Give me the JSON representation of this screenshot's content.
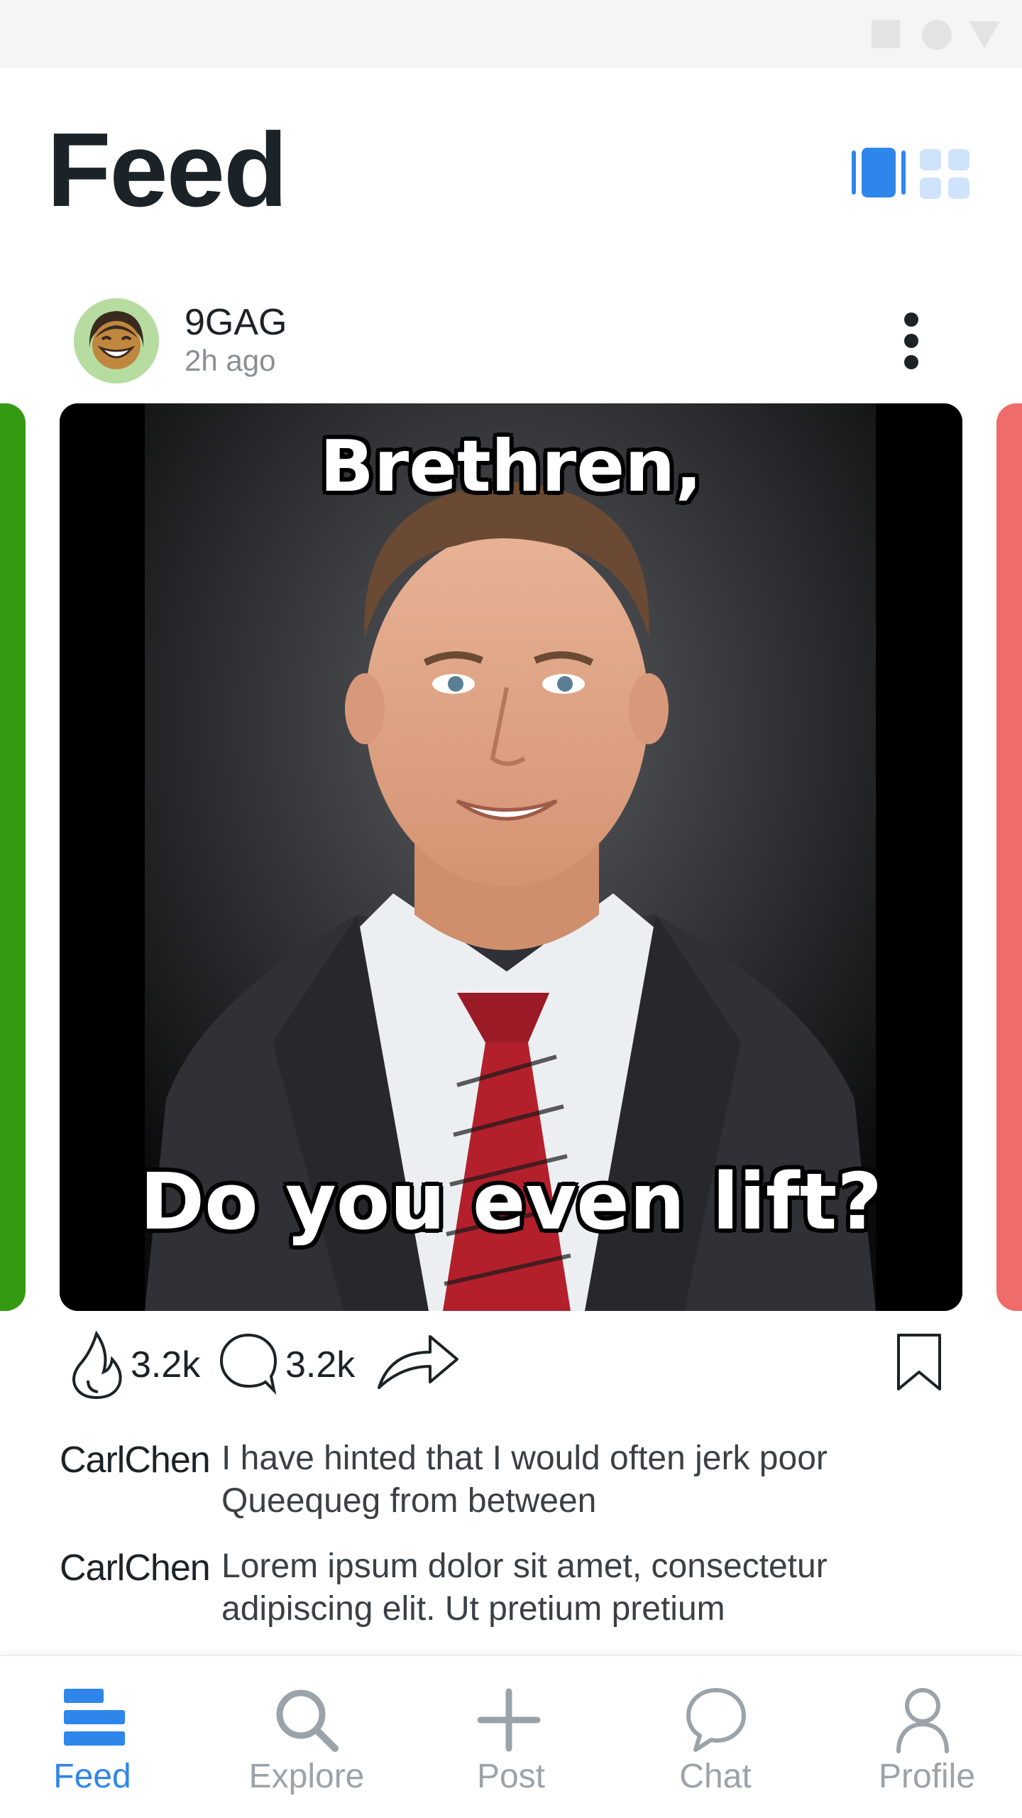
{
  "status_bar": {
    "icons": [
      "square-icon",
      "circle-icon",
      "triangle-icon"
    ]
  },
  "header": {
    "title": "Feed",
    "view_toggle": {
      "single_icon": "single-view-icon",
      "grid_icon": "grid-view-icon",
      "active": "single",
      "accent": "#2f86ea",
      "inactive": "#cfe3fa"
    }
  },
  "post": {
    "author": "9GAG",
    "time": "2h ago",
    "menu_icon": "more-vertical-icon",
    "image": {
      "top_text": "Brethren,",
      "bottom_text": "Do you even lift?"
    },
    "actions": {
      "likes": "3.2k",
      "comments": "3.2k",
      "like_icon": "flame-icon",
      "comment_icon": "comment-bubble-icon",
      "share_icon": "share-arrow-icon",
      "bookmark_icon": "bookmark-icon"
    },
    "comments": [
      {
        "user": "CarlChen",
        "text": "I have hinted that I would often jerk poor Queequeg from between"
      },
      {
        "user": "CarlChen",
        "text": "Lorem ipsum dolor sit amet, consectetur adipiscing elit. Ut pretium pretium"
      }
    ]
  },
  "carousel": {
    "left_card_color": "#339a12",
    "right_card_color": "#ee6c69"
  },
  "bottom_nav": {
    "active": "Feed",
    "active_color": "#2f86ea",
    "inactive_color": "#9ba3aa",
    "items": [
      {
        "label": "Feed",
        "icon": "feed-icon"
      },
      {
        "label": "Explore",
        "icon": "search-icon"
      },
      {
        "label": "Post",
        "icon": "plus-icon"
      },
      {
        "label": "Chat",
        "icon": "chat-icon"
      },
      {
        "label": "Profile",
        "icon": "user-icon"
      }
    ]
  }
}
